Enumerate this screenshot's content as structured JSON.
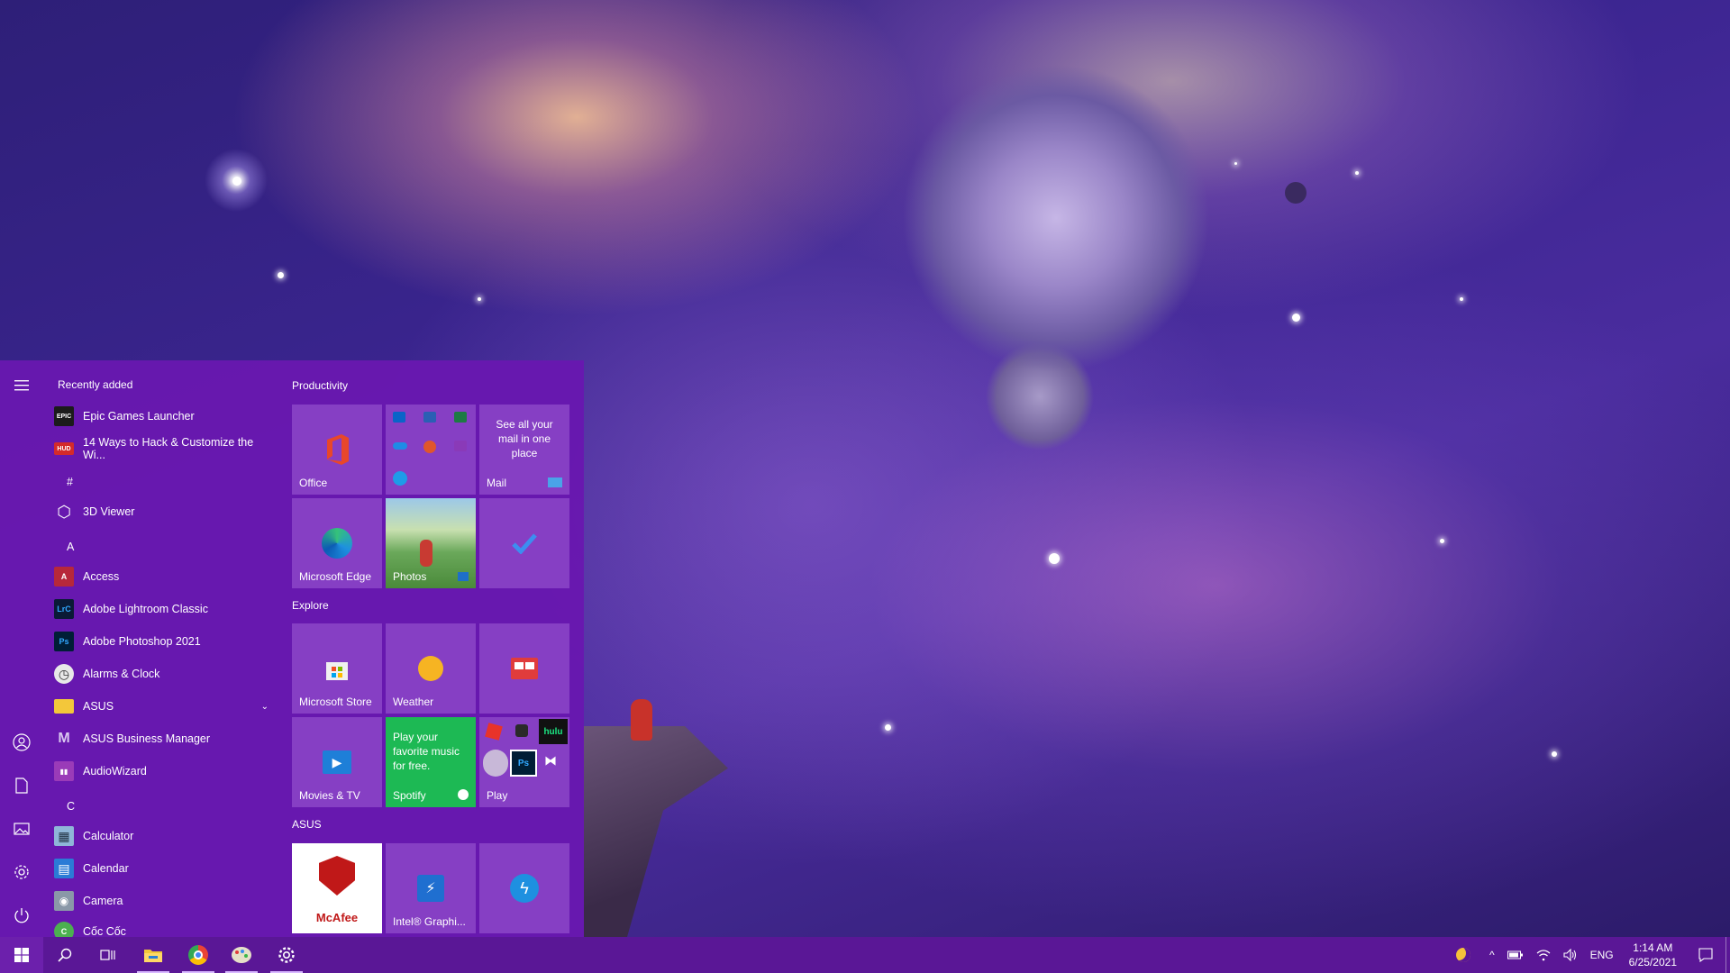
{
  "start_menu": {
    "rail": {
      "menu_icon": "hamburger-icon",
      "bottom_icons": [
        "user-icon",
        "documents-icon",
        "pictures-icon",
        "settings-icon",
        "power-icon"
      ]
    },
    "recently_added_title": "Recently added",
    "recent_apps": [
      {
        "name": "Epic Games Launcher",
        "icon_text": "EPIC"
      },
      {
        "name": "14 Ways to Hack & Customize the Wi...",
        "icon_text": "HUD"
      }
    ],
    "letters": {
      "hash": "#",
      "a": "A",
      "c": "C"
    },
    "apps": [
      {
        "name": "3D Viewer",
        "icon_text": "⬡"
      },
      {
        "name": "Access",
        "icon_text": "A"
      },
      {
        "name": "Adobe Lightroom Classic",
        "icon_text": "LrC"
      },
      {
        "name": "Adobe Photoshop 2021",
        "icon_text": "Ps"
      },
      {
        "name": "Alarms & Clock",
        "icon_text": "◷"
      },
      {
        "name": "ASUS",
        "icon_text": ""
      },
      {
        "name": "ASUS Business Manager",
        "icon_text": "M"
      },
      {
        "name": "AudioWizard",
        "icon_text": "▮▮"
      },
      {
        "name": "Calculator",
        "icon_text": "▦"
      },
      {
        "name": "Calendar",
        "icon_text": "▤"
      },
      {
        "name": "Camera",
        "icon_text": "◉"
      },
      {
        "name": "Cốc Cốc",
        "icon_text": "C"
      }
    ],
    "asus_chevron": "⌄",
    "groups": {
      "productivity": "Productivity",
      "explore": "Explore",
      "asus": "ASUS"
    },
    "tiles": {
      "office": "Office",
      "mail_text": "See all your mail in one place",
      "mail": "Mail",
      "edge": "Microsoft Edge",
      "photos": "Photos",
      "store": "Microsoft Store",
      "weather": "Weather",
      "movies": "Movies & TV",
      "spotify_text": "Play your favorite music for free.",
      "spotify": "Spotify",
      "play": "Play",
      "mcafee": "McAfee",
      "intel": "Intel® Graphi...",
      "hulu": "hulu",
      "ps": "Ps"
    }
  },
  "taskbar": {
    "icons": [
      "windows-start-icon",
      "search-icon",
      "task-view-icon",
      "file-explorer-icon",
      "chrome-icon",
      "paint-icon",
      "settings-icon"
    ],
    "tray": {
      "language": "ENG",
      "time": "1:14 AM",
      "date": "6/25/2021",
      "chevron": "^"
    }
  },
  "colors": {
    "start_bg": "#6818b0",
    "tile_bg": "#8c46c8",
    "taskbar_bg": "#5a1796"
  }
}
